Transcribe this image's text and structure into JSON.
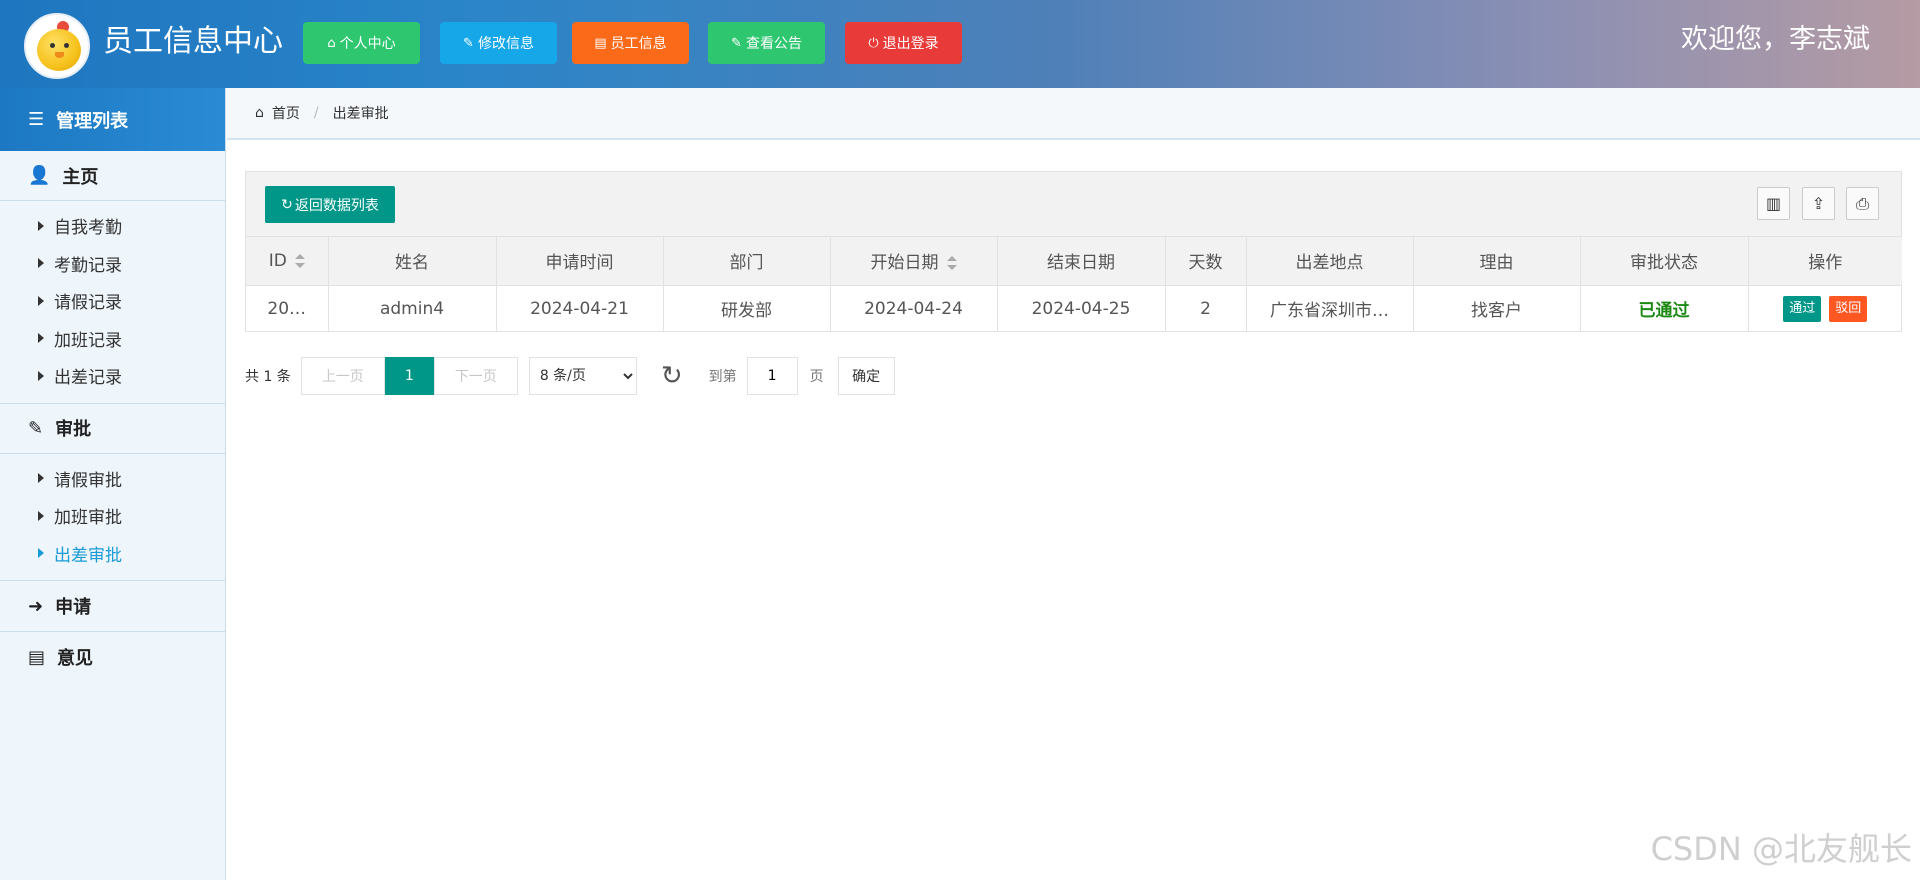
{
  "header": {
    "title": "员工信息中心",
    "welcome": "欢迎您，李志斌",
    "buttons": [
      {
        "label": "个人中心",
        "icon": "home-icon",
        "color": "#2ec770"
      },
      {
        "label": "修改信息",
        "icon": "wrench-icon",
        "color": "#16a7e9"
      },
      {
        "label": "员工信息",
        "icon": "file-icon",
        "color": "#fb6a19"
      },
      {
        "label": "查看公告",
        "icon": "wrench-icon",
        "color": "#2ec770"
      },
      {
        "label": "退出登录",
        "icon": "power-icon",
        "color": "#e83a38"
      }
    ]
  },
  "sidebar": {
    "header": "管理列表",
    "groups": [
      {
        "title": "主页",
        "icon": "user-icon",
        "items": [
          "自我考勤",
          "考勤记录",
          "请假记录",
          "加班记录",
          "出差记录"
        ]
      },
      {
        "title": "审批",
        "icon": "edit-icon",
        "items": [
          "请假审批",
          "加班审批",
          "出差审批"
        ],
        "active_item": "出差审批"
      },
      {
        "title": "申请",
        "icon": "circle-arrow-icon",
        "items": []
      },
      {
        "title": "意见",
        "icon": "file-icon",
        "items": []
      }
    ]
  },
  "breadcrumb": {
    "home": "首页",
    "current": "出差审批"
  },
  "toolbar": {
    "back_label": "返回数据列表",
    "icons": [
      "columns-icon",
      "export-icon",
      "print-icon"
    ]
  },
  "table": {
    "columns": [
      "ID",
      "姓名",
      "申请时间",
      "部门",
      "开始日期",
      "结束日期",
      "天数",
      "出差地点",
      "理由",
      "审批状态",
      "操作"
    ],
    "sortable": [
      "ID",
      "开始日期"
    ],
    "rows": [
      {
        "id": "20…",
        "name": "admin4",
        "apply_time": "2024-04-21",
        "department": "研发部",
        "start_date": "2024-04-24",
        "end_date": "2024-04-25",
        "days": "2",
        "location": "广东省深圳市…",
        "reason": "找客户",
        "status": "已通过",
        "actions": [
          {
            "label": "通过",
            "color": "#009688"
          },
          {
            "label": "驳回",
            "color": "#ff5722"
          }
        ]
      }
    ]
  },
  "pagination": {
    "total": "共 1 条",
    "prev": "上一页",
    "current_page": "1",
    "next": "下一页",
    "page_size": "8 条/页",
    "goto_prefix": "到第",
    "goto_value": "1",
    "goto_suffix": "页",
    "confirm": "确定"
  },
  "watermark": "CSDN @北友舰长"
}
